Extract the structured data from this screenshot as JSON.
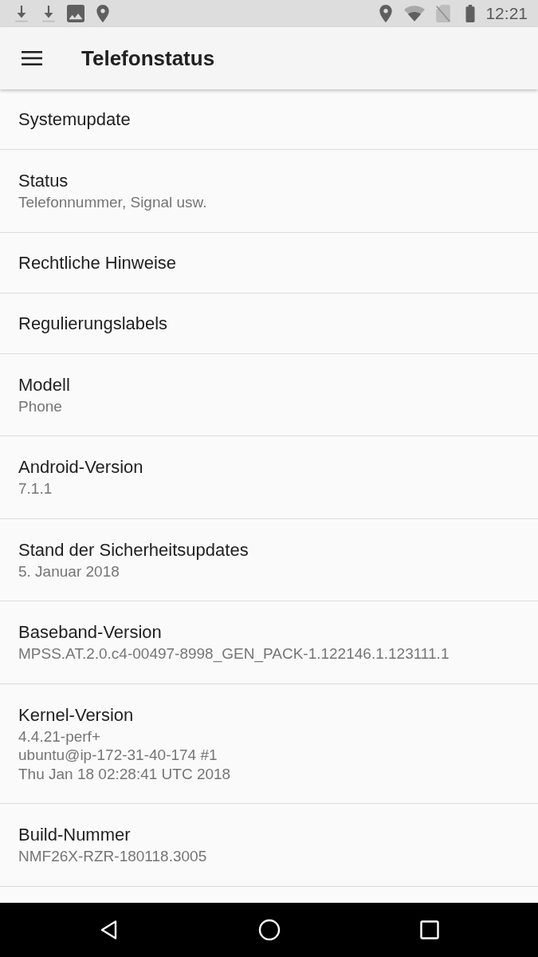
{
  "status_bar": {
    "time": "12:21"
  },
  "app_bar": {
    "title": "Telefonstatus"
  },
  "items": [
    {
      "title": "Systemupdate"
    },
    {
      "title": "Status",
      "summary": "Telefonnummer, Signal usw."
    },
    {
      "title": "Rechtliche Hinweise"
    },
    {
      "title": "Regulierungslabels"
    },
    {
      "title": "Modell",
      "summary": "Phone"
    },
    {
      "title": "Android-Version",
      "summary": "7.1.1"
    },
    {
      "title": "Stand der Sicherheitsupdates",
      "summary": "5. Januar 2018"
    },
    {
      "title": "Baseband-Version",
      "summary": "MPSS.AT.2.0.c4-00497-8998_GEN_PACK-1.122146.1.123111.1"
    },
    {
      "title": "Kernel-Version",
      "summary": "4.4.21-perf+\nubuntu@ip-172-31-40-174 #1\nThu Jan 18 02:28:41 UTC 2018"
    },
    {
      "title": "Build-Nummer",
      "summary": "NMF26X-RZR-180118.3005"
    }
  ]
}
